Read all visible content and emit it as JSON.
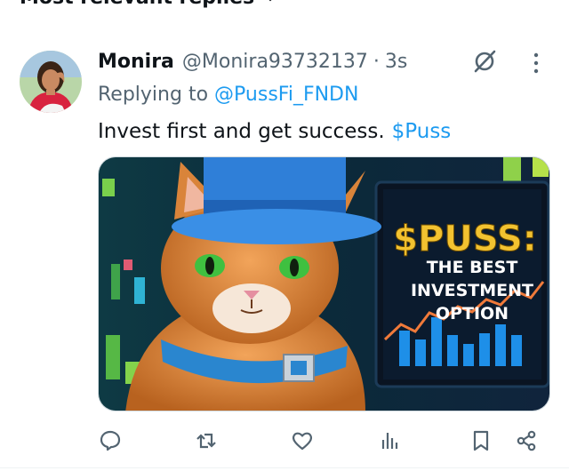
{
  "header": {
    "sort_label": "Most relevant replies"
  },
  "reply": {
    "display_name": "Monira",
    "handle": "@Monira93732137",
    "separator": "·",
    "time": "3s",
    "replying_to_prefix": "Replying to",
    "replying_to_handle": "@PussFi_FNDN",
    "text": "Invest first and get success.",
    "cashtag": "$Puss"
  },
  "media": {
    "headline": "$PUSS:",
    "line1": "THE BEST",
    "line2": "INVESTMENT",
    "line3": "OPTION"
  },
  "icons": {
    "reply": "reply-icon",
    "repost": "repost-icon",
    "like": "heart-icon",
    "views": "views-icon",
    "bookmark": "bookmark-icon",
    "share": "share-icon",
    "grok": "grok-icon",
    "more": "more-icon"
  },
  "colors": {
    "accent": "#1d9bf0",
    "muted": "#536471",
    "text": "#0f1419",
    "headline_gold": "#f2c230"
  }
}
